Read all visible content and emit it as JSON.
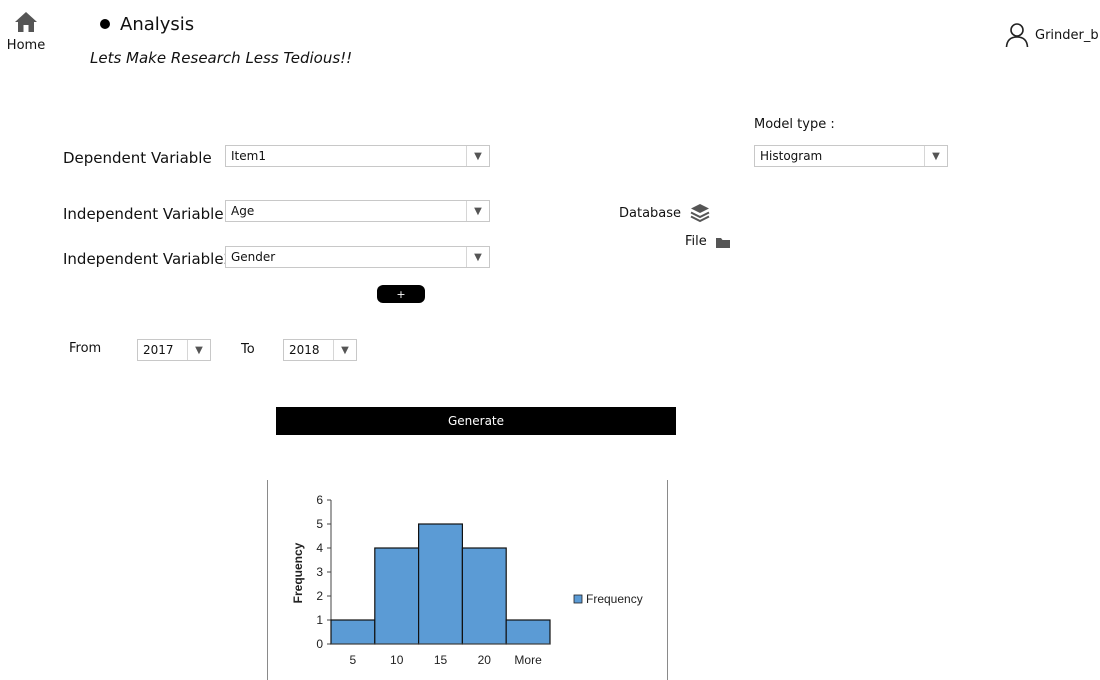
{
  "header": {
    "home_label": "Home",
    "page_title": "Analysis",
    "tagline": "Lets Make Research Less Tedious!!",
    "user_name": "Grinder_b"
  },
  "form": {
    "dependent_label": "Dependent Variable",
    "dependent_value": "Item1",
    "indep1_label": "Independent Variable1",
    "indep1_value": "Age",
    "indep2_label": "Independent Variable2",
    "indep2_value": "Gender",
    "add_label": "+",
    "model_type_label": "Model type :",
    "model_type_value": "Histogram",
    "database_label": "Database",
    "file_label": "File",
    "from_label": "From",
    "from_value": "2017",
    "to_label": "To",
    "to_value": "2018",
    "generate_label": "Generate"
  },
  "icons": {
    "home": "home-icon",
    "user": "user-icon",
    "database": "layers-icon",
    "file": "folder-icon",
    "dropdown": "chevron-down-icon"
  },
  "chart_data": {
    "type": "bar",
    "categories": [
      "5",
      "10",
      "15",
      "20",
      "More"
    ],
    "series": [
      {
        "name": "Frequency",
        "values": [
          1,
          4,
          5,
          4,
          1
        ],
        "color": "#5B9BD5"
      }
    ],
    "ylabel": "Frequency",
    "xlabel": "",
    "ylim": [
      0,
      6
    ],
    "yticks": [
      0,
      1,
      2,
      3,
      4,
      5,
      6
    ],
    "legend": "right"
  }
}
